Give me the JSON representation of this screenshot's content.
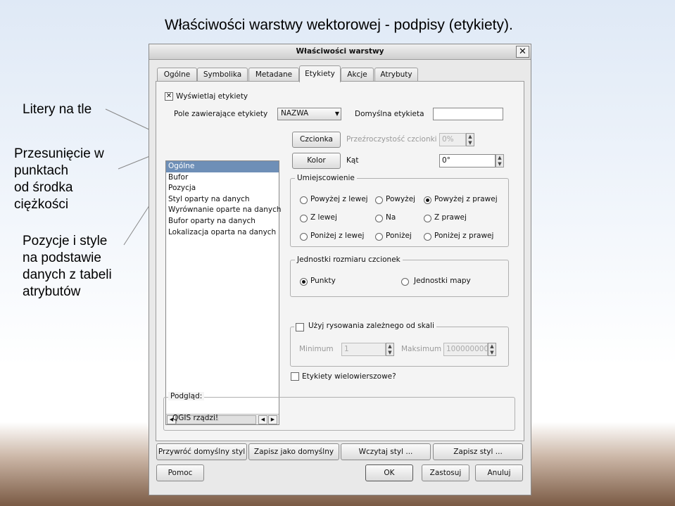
{
  "slide": {
    "title": "Właściwości warstwy wektorowej - podpisy (etykiety).",
    "callouts": {
      "background_letters": "Litery na tle",
      "offset": [
        "Przesunięcie w",
        "punktach",
        "od środka",
        "ciężkości"
      ],
      "positions": [
        "Pozycje i style",
        "na podstawie",
        "danych z tabeli",
        "atrybutów"
      ]
    }
  },
  "dialog": {
    "title": "Właściwości warstwy",
    "close_icon": "close-icon",
    "tabs": [
      "Ogólne",
      "Symbolika",
      "Metadane",
      "Etykiety",
      "Akcje",
      "Atrybuty"
    ],
    "active_tab": "Etykiety",
    "show_labels": {
      "label": "Wyświetlaj etykiety",
      "checked": true
    },
    "field": {
      "label": "Pole zawierające etykiety",
      "value": "NAZWA"
    },
    "default_label": {
      "label": "Domyślna etykieta",
      "value": ""
    },
    "categories": [
      "Ogólne",
      "Bufor",
      "Pozycja",
      "Styl oparty na danych",
      "Wyrównanie oparte na danych",
      "Bufor oparty na danych",
      "Lokalizacja oparta na danych"
    ],
    "selected_category": "Ogólne",
    "font_button": "Czcionka",
    "color_button": "Kolor",
    "transparency": {
      "label": "Przeźroczystość czcionki",
      "value": "0%"
    },
    "angle": {
      "label": "Kąt",
      "value": "0°"
    },
    "placement": {
      "title": "Umiejscowienie",
      "options": [
        [
          "Powyżej z lewej",
          "Powyżej",
          "Powyżej z prawej"
        ],
        [
          "Z lewej",
          "Na",
          "Z prawej"
        ],
        [
          "Poniżej z lewej",
          "Poniżej",
          "Poniżej z prawej"
        ]
      ],
      "selected": "Powyżej z prawej"
    },
    "font_units": {
      "title": "Jednostki rozmiaru czcionek",
      "options": [
        "Punkty",
        "Jednostki mapy"
      ],
      "selected": "Punkty"
    },
    "scale": {
      "label": "Użyj rysowania zależnego od skali",
      "checked": false,
      "min_label": "Minimum",
      "min_value": "1",
      "max_label": "Maksimum",
      "max_value": "100000000"
    },
    "multiline": {
      "label": "Etykiety wielowierszowe?",
      "checked": false
    },
    "preview": {
      "title": "Podgląd:",
      "text": "QGIS rządzi!"
    },
    "buttons": {
      "restore_default": "Przywróć domyślny styl",
      "save_default": "Zapisz jako domyślny",
      "load_style": "Wczytaj styl ...",
      "save_style": "Zapisz styl ...",
      "help": "Pomoc",
      "ok": "OK",
      "apply": "Zastosuj",
      "cancel": "Anuluj"
    }
  }
}
